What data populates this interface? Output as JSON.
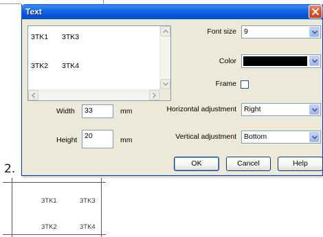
{
  "step_number": "2.",
  "dialog": {
    "title": "Text",
    "close_icon": "close-x-icon",
    "list": {
      "rows": [
        [
          "3TK1",
          "3TK3"
        ],
        [
          "3TK2",
          "3TK4"
        ]
      ]
    },
    "width": {
      "label": "Width",
      "value": "33",
      "unit": "mm"
    },
    "height": {
      "label": "Height",
      "value": "20",
      "unit": "mm"
    },
    "font_size": {
      "label": "Font size",
      "value": "9"
    },
    "color": {
      "label": "Color",
      "value": "#000000"
    },
    "frame": {
      "label": "Frame",
      "checked": false
    },
    "horizontal_adjustment": {
      "label": "Horizontal adjustment",
      "value": "Right"
    },
    "vertical_adjustment": {
      "label": "Vertical adjustment",
      "value": "Bottom"
    },
    "buttons": {
      "ok": "OK",
      "cancel": "Cancel",
      "help": "Help"
    }
  },
  "preview": {
    "rows": [
      [
        "3TK1",
        "3TK3"
      ],
      [
        "3TK2",
        "3TK4"
      ]
    ]
  },
  "colors": {
    "title_bar": "#0a5fdd",
    "dialog_face": "#ece9d8",
    "close_button": "#e0562c",
    "input_border": "#7f9db9"
  }
}
